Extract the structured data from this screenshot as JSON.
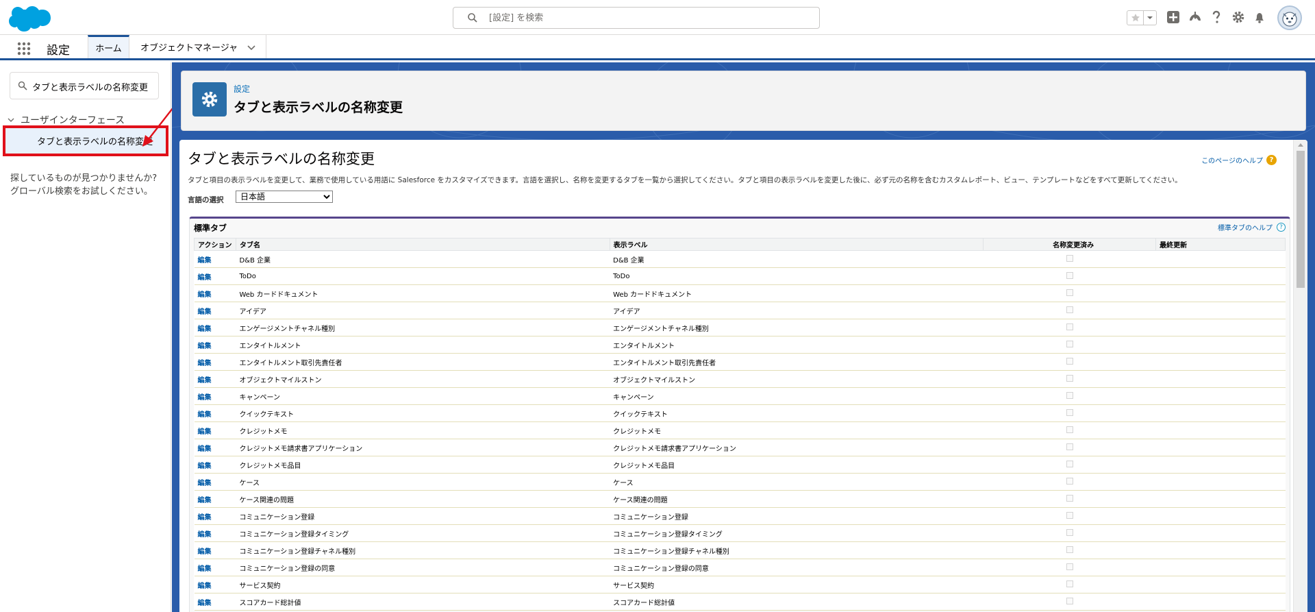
{
  "header": {
    "search_placeholder": "[設定] を検索"
  },
  "context_bar": {
    "app_name": "設定",
    "tabs": [
      {
        "label": "ホーム"
      },
      {
        "label": "オブジェクトマネージャ"
      }
    ]
  },
  "sidebar": {
    "quick_find_value": "タブと表示ラベルの名称変更",
    "tree_group": "ユーザインターフェース",
    "tree_item": "タブと表示ラベルの名称変更",
    "not_found_text": "探しているものが見つかりませんか? グローバル検索をお試しください。"
  },
  "page_header": {
    "breadcrumb": "設定",
    "title": "タブと表示ラベルの名称変更"
  },
  "content": {
    "title": "タブと表示ラベルの名称変更",
    "help_link": "このページのヘルプ",
    "description": "タブと項目の表示ラベルを変更して、業務で使用している用語に Salesforce をカスタマイズできます。言語を選択し、名称を変更するタブを一覧から選択してください。タブと項目の表示ラベルを変更した後に、必ず元の名称を含むカスタムレポート、ビュー、テンプレートなどをすべて更新してください。",
    "language_label": "言語の選択",
    "language_selected": "日本語"
  },
  "standard_tabs": {
    "title": "標準タブ",
    "help_link": "標準タブのヘルプ",
    "columns": {
      "action": "アクション",
      "tab_name": "タブ名",
      "display_label": "表示ラベル",
      "renamed": "名称変更済み",
      "last_modified": "最終更新"
    },
    "rows": [
      {
        "action": "編集",
        "tab_name": "D&B 企業",
        "display_label": "D&B 企業"
      },
      {
        "action": "編集",
        "tab_name": "ToDo",
        "display_label": "ToDo"
      },
      {
        "action": "編集",
        "tab_name": "Web カードドキュメント",
        "display_label": "Web カードドキュメント"
      },
      {
        "action": "編集",
        "tab_name": "アイデア",
        "display_label": "アイデア"
      },
      {
        "action": "編集",
        "tab_name": "エンゲージメントチャネル種別",
        "display_label": "エンゲージメントチャネル種別"
      },
      {
        "action": "編集",
        "tab_name": "エンタイトルメント",
        "display_label": "エンタイトルメント"
      },
      {
        "action": "編集",
        "tab_name": "エンタイトルメント取引先責任者",
        "display_label": "エンタイトルメント取引先責任者"
      },
      {
        "action": "編集",
        "tab_name": "オブジェクトマイルストン",
        "display_label": "オブジェクトマイルストン"
      },
      {
        "action": "編集",
        "tab_name": "キャンペーン",
        "display_label": "キャンペーン"
      },
      {
        "action": "編集",
        "tab_name": "クイックテキスト",
        "display_label": "クイックテキスト"
      },
      {
        "action": "編集",
        "tab_name": "クレジットメモ",
        "display_label": "クレジットメモ"
      },
      {
        "action": "編集",
        "tab_name": "クレジットメモ請求書アプリケーション",
        "display_label": "クレジットメモ請求書アプリケーション"
      },
      {
        "action": "編集",
        "tab_name": "クレジットメモ品目",
        "display_label": "クレジットメモ品目"
      },
      {
        "action": "編集",
        "tab_name": "ケース",
        "display_label": "ケース"
      },
      {
        "action": "編集",
        "tab_name": "ケース関連の問題",
        "display_label": "ケース関連の問題"
      },
      {
        "action": "編集",
        "tab_name": "コミュニケーション登録",
        "display_label": "コミュニケーション登録"
      },
      {
        "action": "編集",
        "tab_name": "コミュニケーション登録タイミング",
        "display_label": "コミュニケーション登録タイミング"
      },
      {
        "action": "編集",
        "tab_name": "コミュニケーション登録チャネル種別",
        "display_label": "コミュニケーション登録チャネル種別"
      },
      {
        "action": "編集",
        "tab_name": "コミュニケーション登録の同意",
        "display_label": "コミュニケーション登録の同意"
      },
      {
        "action": "編集",
        "tab_name": "サービス契約",
        "display_label": "サービス契約"
      },
      {
        "action": "編集",
        "tab_name": "スコアカード総計値",
        "display_label": "スコアカード総計値"
      }
    ]
  },
  "colors": {
    "brand_blue": "#00A1E0",
    "nav_blue": "#1B5297",
    "link_blue": "#015BA7",
    "highlight_red": "#E0101A",
    "background_blue": "#2A5CAA"
  },
  "icons": {
    "logo": "salesforce-cloud-logo",
    "search": "search-icon",
    "favorites": "star-icon",
    "add": "plus-icon",
    "trailhead": "trailhead-icon",
    "help": "question-icon",
    "setup": "gear-icon",
    "notifications": "bell-icon",
    "apps": "app-launcher-icon"
  }
}
